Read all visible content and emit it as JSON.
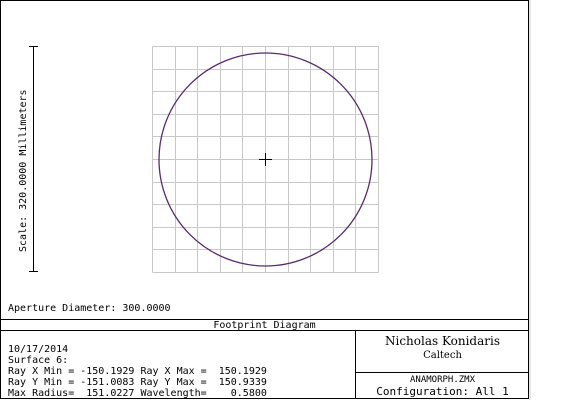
{
  "plot": {
    "scale_label": "Scale:  320.0000 Millimeters",
    "aperture_label": "Aperture Diameter: 300.0000",
    "grid_divisions": 10
  },
  "title_block": {
    "diagram_title": "Footprint Diagram",
    "info_lines": [
      "10/17/2014",
      "Surface 6:",
      "Ray X Min = -150.1929 Ray X Max =  150.1929",
      "Ray Y Min = -151.0083 Ray Y Max =  150.9339",
      "Max Radius=  151.0227 Wavelength=    0.5800"
    ],
    "author": "Nicholas Konidaris",
    "institution": "Caltech",
    "file_name": "ANAMORPH.ZMX",
    "configuration": "Configuration: All 1"
  },
  "colors": {
    "grid": "#c8c8c8",
    "footprint": "#5a2a6e",
    "frame": "#000000"
  }
}
